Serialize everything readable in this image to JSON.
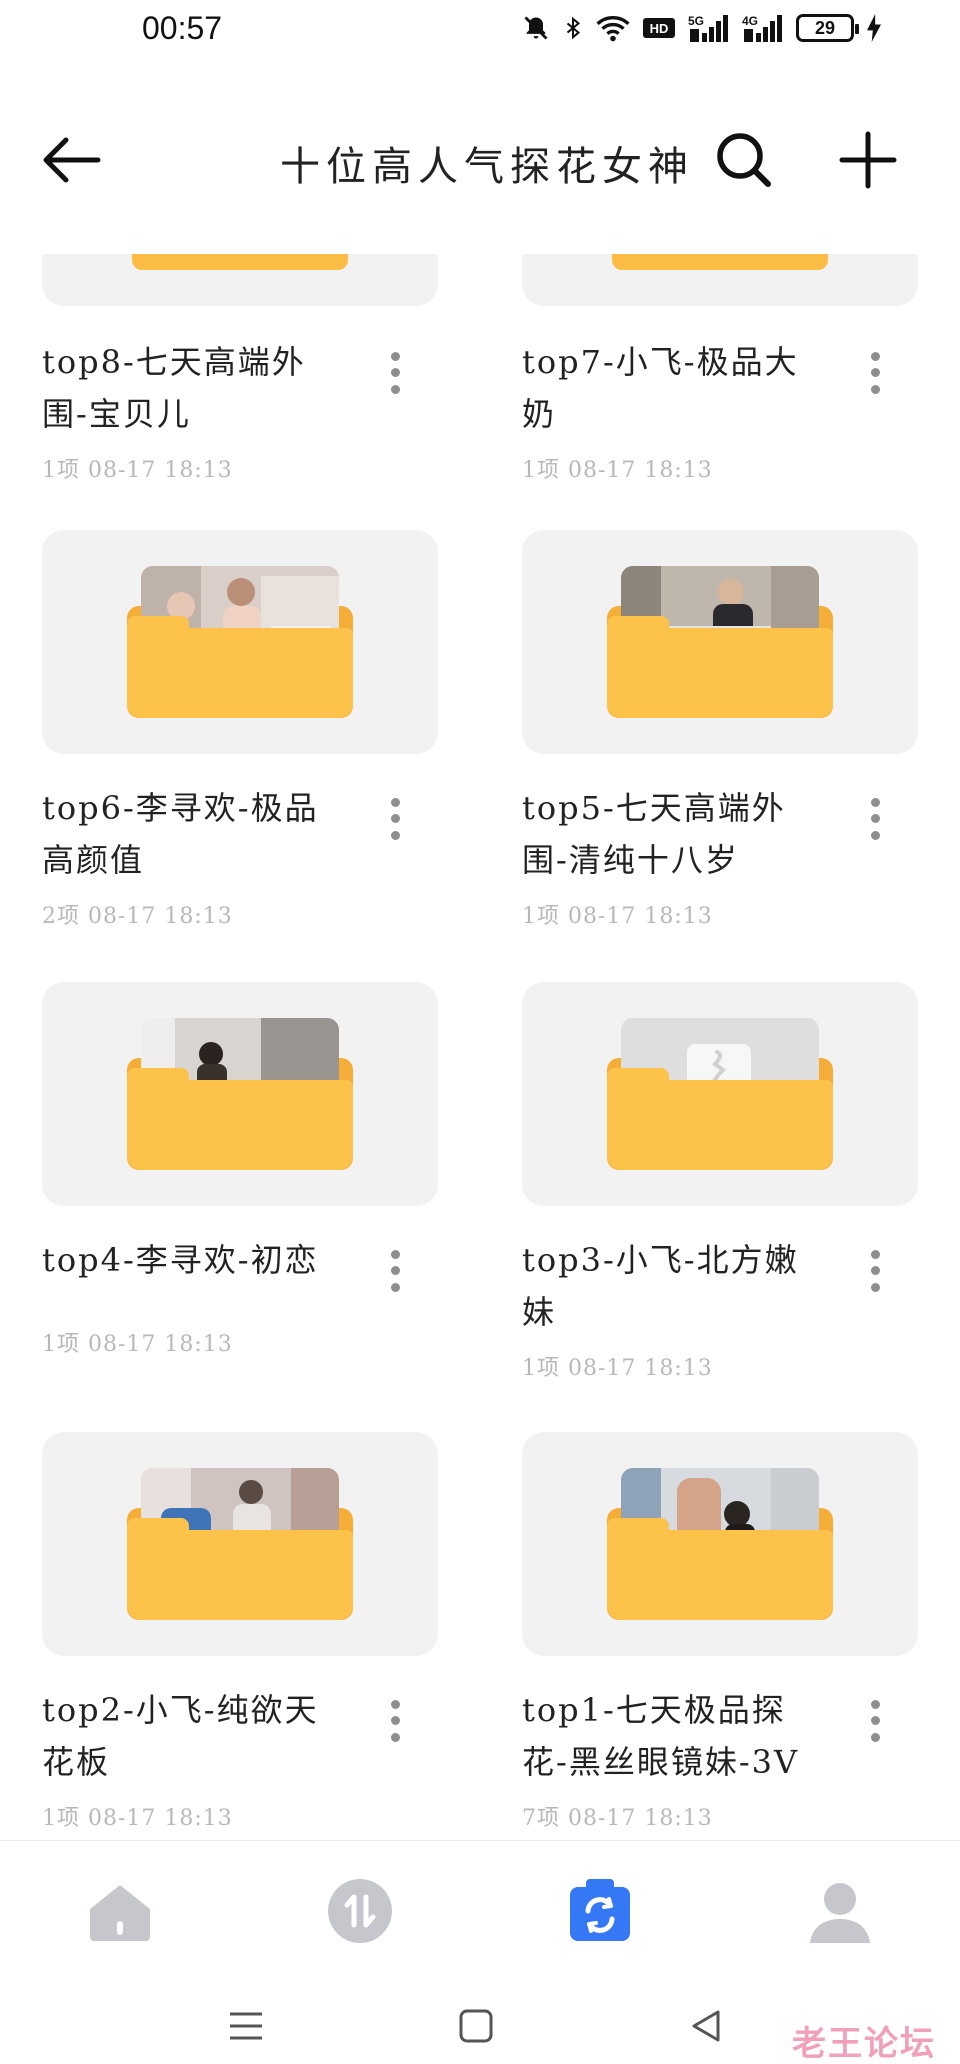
{
  "status_bar": {
    "time": "00:57",
    "battery": "29",
    "signal_labels": [
      "HD",
      "5G",
      "4G"
    ]
  },
  "header": {
    "title": "十位高人气探花女神"
  },
  "folders": [
    {
      "name": "top8-七天高端外围-宝贝儿",
      "meta": "1项  08-17 18:13"
    },
    {
      "name": "top7-小飞-极品大奶",
      "meta": "1项  08-17 18:13"
    },
    {
      "name": "top6-李寻欢-极品高颜值",
      "meta": "2项  08-17 18:13"
    },
    {
      "name": "top5-七天高端外围-清纯十八岁",
      "meta": "1项  08-17 18:13"
    },
    {
      "name": "top4-李寻欢-初恋",
      "meta": "1项  08-17 18:13"
    },
    {
      "name": "top3-小飞-北方嫩妹",
      "meta": "1项  08-17 18:13"
    },
    {
      "name": "top2-小飞-纯欲天花板",
      "meta": "1项  08-17 18:13"
    },
    {
      "name": "top1-七天极品探花-黑丝眼镜妹-3V",
      "meta": "7项  08-17 18:13"
    }
  ],
  "bottom_nav": {
    "items": [
      "home-icon",
      "transfer-icon",
      "files-icon",
      "profile-icon"
    ],
    "active": "files-icon"
  },
  "watermark": "老王论坛",
  "colors": {
    "folder": "#fcc24a",
    "card": "#f2f2f3",
    "active_nav": "#3478f6",
    "meta_text": "#b8b8b8"
  }
}
